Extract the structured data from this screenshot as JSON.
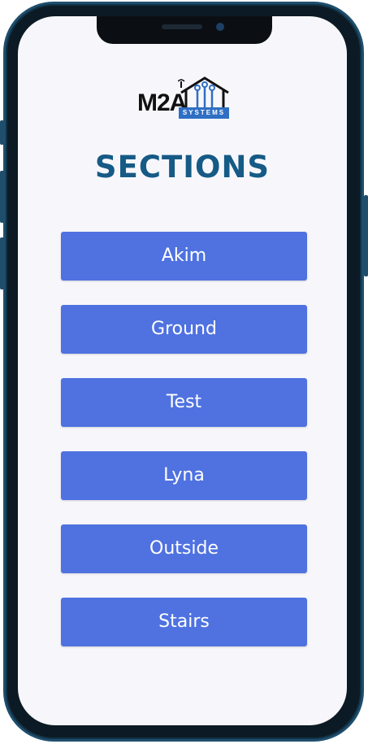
{
  "brand": {
    "logo_text": "M2A",
    "logo_badge": "SYSTEMS"
  },
  "page": {
    "title": "SECTIONS"
  },
  "sections": [
    {
      "label": "Akim"
    },
    {
      "label": "Ground"
    },
    {
      "label": "Test"
    },
    {
      "label": "Lyna"
    },
    {
      "label": "Outside"
    },
    {
      "label": "Stairs"
    }
  ],
  "colors": {
    "button": "#4f72e0",
    "title": "#165a86",
    "screen_bg": "#f7f7fb",
    "badge": "#2f6fc4"
  }
}
